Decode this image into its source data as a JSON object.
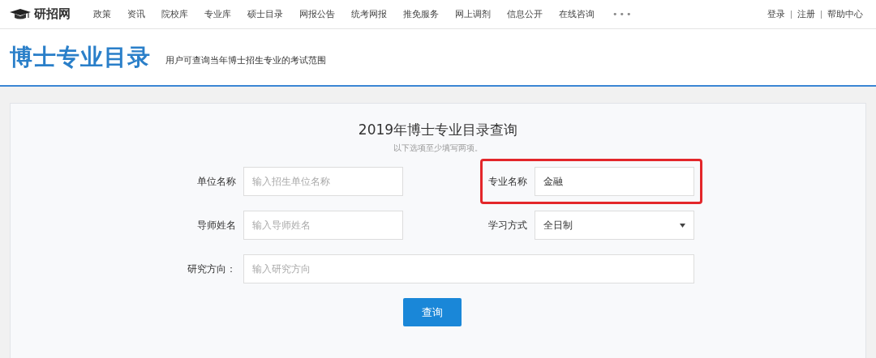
{
  "nav": {
    "logo": "研招网",
    "items": [
      "政策",
      "资讯",
      "院校库",
      "专业库",
      "硕士目录",
      "网报公告",
      "统考网报",
      "推免服务",
      "网上调剂",
      "信息公开",
      "在线咨询"
    ],
    "more": "•••",
    "account_links": [
      "登录",
      "注册",
      "帮助中心"
    ]
  },
  "header": {
    "title": "博士专业目录",
    "subtitle": "用户可查询当年博士招生专业的考试范围"
  },
  "query": {
    "title": "2019年博士专业目录查询",
    "hint": "以下选项至少填写两项。",
    "fields": [
      {
        "kind": "text",
        "label": "单位名称",
        "placeholder": "输入招生单位名称",
        "wide": false
      },
      {
        "kind": "text",
        "label": "专业名称",
        "value": "金融",
        "wide": false,
        "highlighted": true
      },
      {
        "kind": "text",
        "label": "导师姓名",
        "placeholder": "输入导师姓名",
        "wide": false
      },
      {
        "kind": "select",
        "label": "学习方式",
        "value": "全日制",
        "wide": false
      },
      {
        "kind": "text",
        "label": "研究方向：",
        "placeholder": "输入研究方向",
        "wide": true
      }
    ],
    "button": "查询"
  }
}
